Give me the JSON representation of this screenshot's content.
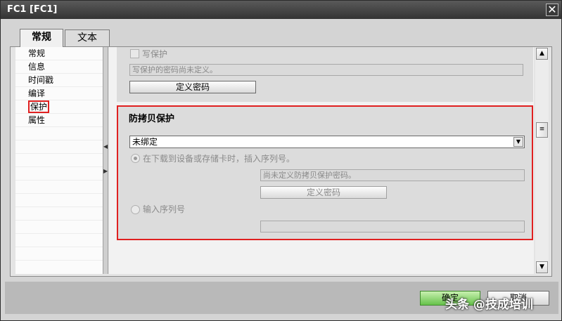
{
  "window": {
    "title": "FC1 [FC1]",
    "close_glyph": "✕"
  },
  "tabs": [
    {
      "label": "常规",
      "active": true
    },
    {
      "label": "文本",
      "active": false
    }
  ],
  "nav": {
    "items": [
      "常规",
      "信息",
      "时间戳",
      "编译",
      "保护",
      "属性"
    ],
    "selected": "保护"
  },
  "write_protect": {
    "checkbox_label": "写保护",
    "password_status": "写保护的密码尚未定义。",
    "define_button": "定义密码"
  },
  "copy_protect": {
    "title": "防拷贝保护",
    "binding_select": "未绑定",
    "radio_serial_download": "在下载到设备或存储卡时，插入序列号。",
    "password_status": "尚未定义防拷贝保护密码。",
    "define_button": "定义密码",
    "radio_enter_serial": "输入序列号",
    "serial_value": ""
  },
  "icons": {
    "scroll_up": "chevron-up-icon",
    "scroll_down": "chevron-down-icon",
    "select_arrow": "chevron-down-icon"
  },
  "footer": {
    "ok_label": "确定",
    "cancel_label": "取消"
  },
  "watermark": "头条 @技成培训",
  "colors": {
    "highlight": "#e02020",
    "ok_green": "#66c24a",
    "title_bg": "#333333"
  }
}
